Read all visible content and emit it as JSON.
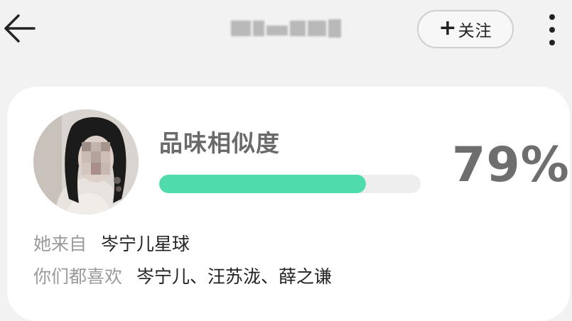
{
  "header": {
    "back_icon": "arrow-left-icon",
    "username": "",
    "follow_button": {
      "icon": "plus-icon",
      "label": "关注"
    },
    "more_icon": "more-vertical-icon"
  },
  "profile_card": {
    "similarity": {
      "title": "品味相似度",
      "percent_text": "79%",
      "percent": 79
    },
    "from": {
      "label": "她来自",
      "value": "岑宁儿星球"
    },
    "common_likes": {
      "label": "你们都喜欢",
      "value": "岑宁儿、汪苏泷、薛之谦"
    }
  },
  "colors": {
    "background": "#f2f2f2",
    "card": "#ffffff",
    "progress_fill": "#4fdbab",
    "progress_track": "#eeeeee",
    "primary_text": "#222222",
    "secondary_text": "#9a9a9a"
  }
}
